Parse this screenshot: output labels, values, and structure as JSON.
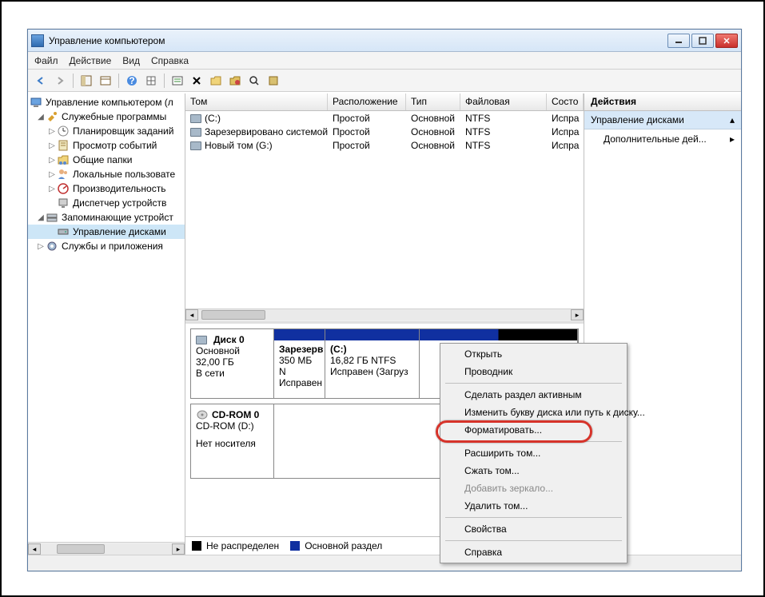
{
  "window": {
    "title": "Управление компьютером"
  },
  "menu": {
    "file": "Файл",
    "action": "Действие",
    "view": "Вид",
    "help": "Справка"
  },
  "tree": {
    "root": "Управление компьютером (л",
    "sys_tools": "Служебные программы",
    "scheduler": "Планировщик заданий",
    "eventvwr": "Просмотр событий",
    "shared": "Общие папки",
    "users": "Локальные пользовате",
    "perf": "Производительность",
    "devmgr": "Диспетчер устройств",
    "storage": "Запоминающие устройст",
    "diskmgmt": "Управление дисками",
    "services": "Службы и приложения"
  },
  "vol_cols": {
    "tom": "Том",
    "loc": "Расположение",
    "type": "Тип",
    "fs": "Файловая система",
    "stat": "Состо"
  },
  "volumes": [
    {
      "name": "(C:)",
      "loc": "Простой",
      "type": "Основной",
      "fs": "NTFS",
      "stat": "Испра"
    },
    {
      "name": "Зарезервировано системой",
      "loc": "Простой",
      "type": "Основной",
      "fs": "NTFS",
      "stat": "Испра"
    },
    {
      "name": "Новый том (G:)",
      "loc": "Простой",
      "type": "Основной",
      "fs": "NTFS",
      "stat": "Испра"
    }
  ],
  "disk0": {
    "title": "Диск 0",
    "type": "Основной",
    "size": "32,00 ГБ",
    "status": "В сети",
    "p1_name": "Зарезерв",
    "p1_size": "350 МБ N",
    "p1_stat": "Исправен",
    "p2_name": "(C:)",
    "p2_size": "16,82 ГБ NTFS",
    "p2_stat": "Исправен (Загруз"
  },
  "cdrom": {
    "title": "CD-ROM 0",
    "type": "CD-ROM (D:)",
    "status": "Нет носителя"
  },
  "legend": {
    "unalloc": "Не распределен",
    "primary": "Основной раздел"
  },
  "actions": {
    "title": "Действия",
    "group": "Управление дисками",
    "more": "Дополнительные дей..."
  },
  "ctx": {
    "open": "Открыть",
    "explorer": "Проводник",
    "active": "Сделать раздел активным",
    "letter": "Изменить букву диска или путь к диску...",
    "format": "Форматировать...",
    "extend": "Расширить том...",
    "shrink": "Сжать том...",
    "mirror": "Добавить зеркало...",
    "delete": "Удалить том...",
    "props": "Свойства",
    "help": "Справка"
  }
}
